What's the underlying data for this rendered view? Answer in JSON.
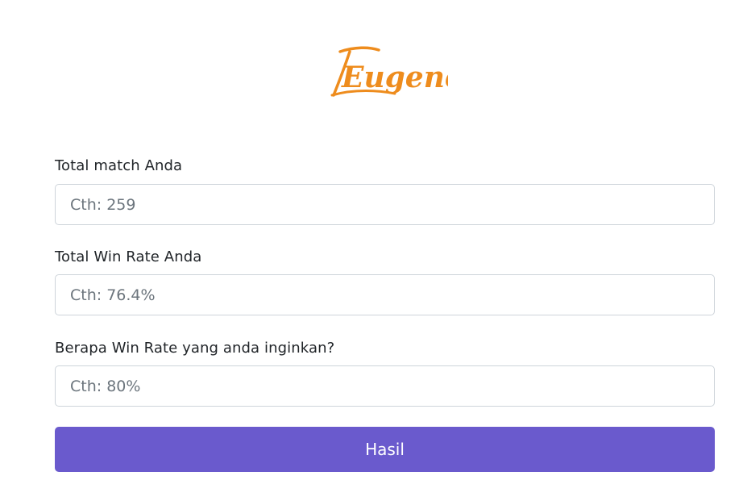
{
  "logo": {
    "text": "Eugene",
    "color": "#ee8c1d"
  },
  "form": {
    "fields": [
      {
        "label": "Total match Anda",
        "placeholder": "Cth: 259",
        "value": ""
      },
      {
        "label": "Total Win Rate Anda",
        "placeholder": "Cth: 76.4%",
        "value": ""
      },
      {
        "label": "Berapa Win Rate yang anda inginkan?",
        "placeholder": "Cth: 80%",
        "value": ""
      }
    ],
    "submit_label": "Hasil"
  },
  "colors": {
    "accent": "#6a5acd",
    "logo": "#ee8c1d",
    "text": "#212529",
    "placeholder": "#6c757d",
    "border": "#ced4da"
  }
}
